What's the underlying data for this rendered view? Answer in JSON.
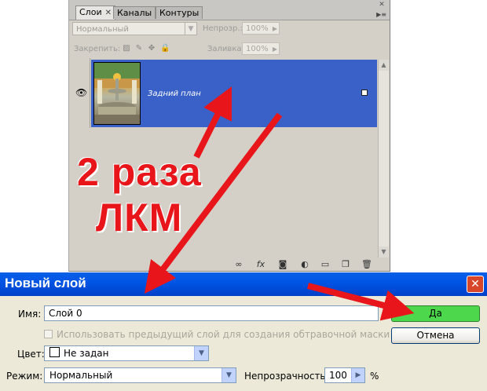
{
  "layers_panel": {
    "tabs": [
      {
        "label": "Слои",
        "active": true
      },
      {
        "label": "Каналы",
        "active": false
      },
      {
        "label": "Контуры",
        "active": false
      }
    ],
    "blend_mode_value": "Нормальный",
    "opacity_label": "Непрозр.:",
    "opacity_value": "100%",
    "lock_label": "Закрепить:",
    "fill_label": "Заливка:",
    "fill_value": "100%",
    "layer_name": "Задний план"
  },
  "annotation": {
    "line1": "2 раза",
    "line2": "ЛКМ"
  },
  "new_layer_dialog": {
    "title": "Новый слой",
    "name_label": "Имя:",
    "name_value": "Слой 0",
    "clip_mask_checkbox_label": "Использовать предыдущий слой для создания обтравочной маски",
    "color_label": "Цвет:",
    "color_value": "Не задан",
    "mode_label": "Режим:",
    "mode_value": "Нормальный",
    "opacity_label": "Непрозрачность:",
    "opacity_value": "100",
    "opacity_unit": "%",
    "ok_label": "Да",
    "cancel_label": "Отмена"
  },
  "colors": {
    "selected_layer": "#3a61c7",
    "annotation_red": "#e8161a",
    "dialog_title_blue": "#0055e5",
    "ok_highlight": "#4cd74c"
  }
}
